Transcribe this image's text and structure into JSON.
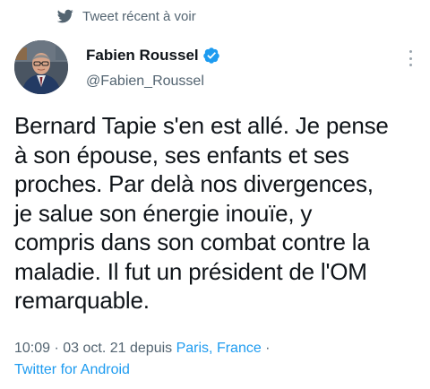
{
  "promo": {
    "icon": "twitter-bird-icon",
    "text": "Tweet récent à voir"
  },
  "author": {
    "name": "Fabien Roussel",
    "handle": "@Fabien_Roussel",
    "verified_icon": "verified-badge-icon",
    "verified_color": "#1d9bf0"
  },
  "tweet": {
    "lines": [
      "Bernard Tapie s'en est allé. Je pense",
      "à son épouse, ses enfants et ses",
      "proches. Par delà nos divergences,",
      "je salue son énergie inouïe, y",
      "compris dans son combat contre la",
      "maladie. Il fut un président de l'OM",
      "remarquable."
    ]
  },
  "meta": {
    "time": "10:09",
    "separator": " · ",
    "date": "03 oct. 21",
    "via": " depuis ",
    "location": "Paris, France",
    "trailing_separator": " ·",
    "client": "Twitter for Android",
    "link_color": "#1d9bf0"
  },
  "menu": {
    "icon": "more-options-icon"
  }
}
